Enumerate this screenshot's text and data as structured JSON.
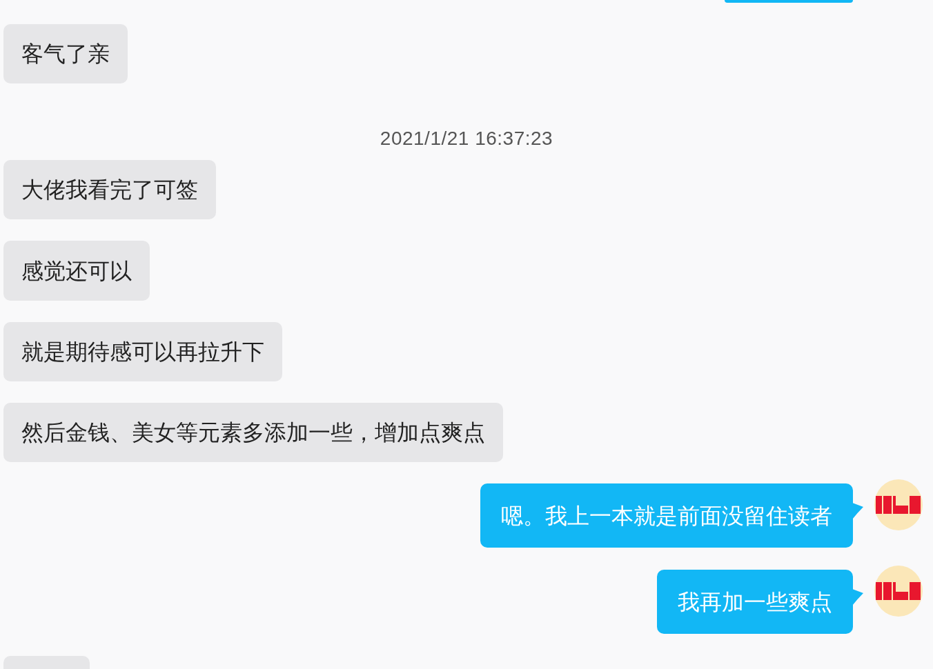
{
  "messages": [
    {
      "kind": "outstub"
    },
    {
      "kind": "incoming",
      "text": "客气了亲"
    },
    {
      "kind": "time",
      "text": "2021/1/21 16:37:23"
    },
    {
      "kind": "incoming",
      "text": "大佬我看完了可签"
    },
    {
      "kind": "incoming",
      "text": "感觉还可以"
    },
    {
      "kind": "incoming",
      "text": "就是期待感可以再拉升下"
    },
    {
      "kind": "incoming",
      "text": "然后金钱、美女等元素多添加一些，增加点爽点"
    },
    {
      "kind": "outgoing",
      "text": "嗯。我上一本就是前面没留住读者"
    },
    {
      "kind": "outgoing",
      "text": "我再加一些爽点"
    },
    {
      "kind": "instub"
    }
  ]
}
